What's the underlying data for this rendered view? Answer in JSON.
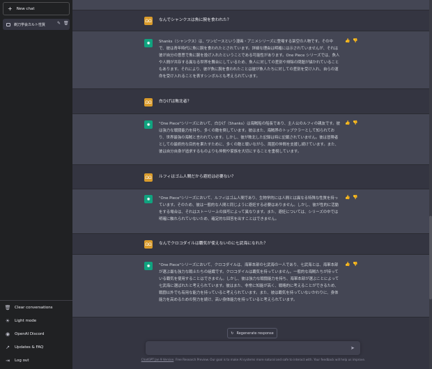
{
  "sidebar": {
    "new_chat": "New chat",
    "chat_title": "剃刀学会カルト性質",
    "links": [
      {
        "label": "Clear conversations",
        "icon": "trash-icon"
      },
      {
        "label": "Light mode",
        "icon": "sun-icon"
      },
      {
        "label": "OpenAI Discord",
        "icon": "discord-icon"
      },
      {
        "label": "Updates & FAQ",
        "icon": "external-link-icon"
      },
      {
        "label": "Log out",
        "icon": "logout-icon"
      }
    ]
  },
  "messages": [
    {
      "role": "user",
      "text": "なんでシャンクスは魚に腕を食われた？"
    },
    {
      "role": "assistant",
      "text": "Shanks（シャンクス）は、ワンピースという漫画・アニメシリーズに登場する架空の人物です。その中で、彼は青年時代に魚に腕を食われたとされています。詳細な理由は明確には示されていませんが、それは彼が自分の意思で魚に腕を投げ入れたということである可能性があります。One Piece シリーズでは、魚人や人間が共存する異なる世界を舞台にしているため、魚人に対しての差別や排除の問題が描かれていることもあります。それにより、彼が魚に腕を食われたことは彼が魚人たちに対しての差別を受け入れ、自らの運命を受け入れることを表すシンボルとも考えられています。"
    },
    {
      "role": "user",
      "text": "白ひげは敗北者？"
    },
    {
      "role": "assistant",
      "text": "\"One Piece\"シリーズにおいて、白ひげ（Shanks）は海賊船の船長であり、主人公のルフィの親友です。彼は強力な戦闘能力を持ち、多くの敵を倒しています。彼はまた、海賊界のトップクラーとして知られており、世界最強の海賊と言われています。しかし、彼が敗北した記録は特に記載されていません。彼は冒険者としての最終的な目的を果たすために、多くの敵と戦いながら、周囲の仲間を支援し続けています。また、彼は自分自身が追求するものよりも仲間や家族を大切にすることを重視しています。"
    },
    {
      "role": "user",
      "text": "ルフィはゴム人間だから避妊は必要ない？"
    },
    {
      "role": "assistant",
      "text": "\"One Piece\"シリーズにおいて、ルフィはゴム人間であり、生物学的には人間とは異なる特殊な性質を持っています。そのため、彼は一般的な人間と同じように避妊する必要はありません。しかし、彼が性的に活動をする場合は、それはストーリー上の描写によって異なります。また、避妊については、シリーズの中では明確に触れられていないため、確定的な回答を出すことはできません。"
    },
    {
      "role": "user",
      "text": "なんでクロコダイルは覇気が使えないのに七武海になれた？"
    },
    {
      "role": "assistant",
      "text": "\"One Piece\"シリーズにおいて、クロコダイルは、海軍本部の七武海の一人であり、七武海とは、海軍本部が選ぶ最も強力な戦士たちの組織です。クロコダイルは覇気を持っていません。一般的な海賊たちが持っている覇気を使用することはできません。しかし、彼は強力な戦闘能力を持ち、海軍本部が選ぶことによって七武海に選ばれたと考えられています。彼はまた、非常に知能が高く、戦略的に考えることができるため、戦闘以外でも有用な能力を持っていると考えられています。また、彼は覇気を持っていないかわりに、身体能力を高めるための努力を続け、高い身体能力を持っていると考えられています。"
    }
  ],
  "regenerate_label": "Regenerate response",
  "footer": {
    "link": "ChatGPT Jan 9 Version",
    "text": ". Free Research Preview. Our goal is to make AI systems more natural and safe to interact with. Your feedback will help us improve."
  }
}
